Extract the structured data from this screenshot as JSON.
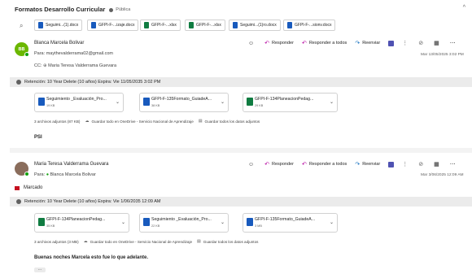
{
  "thread": {
    "title": "Formatos Desarrollo Curricular",
    "visibility": "Pública",
    "collapse_glyph": "^"
  },
  "top_attachments": [
    {
      "name": "Seguimi...(1).docx",
      "kind": "word"
    },
    {
      "name": "GFPI-F-...izaje.docx",
      "kind": "word"
    },
    {
      "name": "GFPI-F-...xlsx",
      "kind": "excel"
    },
    {
      "name": "GFPI-F-...xlsx",
      "kind": "excel"
    },
    {
      "name": "Seguimi...(1)ro.docx",
      "kind": "word"
    },
    {
      "name": "GFPI-F-...sionv.docx",
      "kind": "word"
    }
  ],
  "actions": {
    "reply": "Responder",
    "reply_all": "Responder a todos",
    "forward": "Reenviar"
  },
  "colors": {
    "avatar1": "#6bb700",
    "word": "#185abd",
    "excel": "#107c41",
    "apps": "#4f52b2",
    "reply_icon": "#b4009e",
    "forward_icon": "#0f6cbd",
    "flag": "#c50f1f"
  },
  "messages": [
    {
      "initials": "BB",
      "sender": "Blanca Marcela Bolivar",
      "to_label": "Para:",
      "to": "maythevalderrama02@gmail.com",
      "cc_label": "CC:",
      "cc": "Maria Teresa Valderrama Guevara",
      "date": "Mar 13/05/2025 3:02 PM",
      "retention": "Retención: 10 Year Delete (10 años) Expira: Vie 11/05/2035 3:02 PM",
      "attachments": [
        {
          "name": "Seguimiento _Evaluación_Pro...",
          "size": "19 KB",
          "kind": "word"
        },
        {
          "name": "GFPI-F-135Formato_GuiadeA...",
          "size": "38 KB",
          "kind": "word"
        },
        {
          "name": "GFPI-F-134PlaneacionPedag...",
          "size": "29 KB",
          "kind": "excel"
        }
      ],
      "attachments_summary": "3 archivos adjuntos (87 KB)",
      "save_onedrive": "Guardar todo en OneDrive - Servicio Nacional de Aprendizaje",
      "save_all": "Guardar todos los datos adjuntos",
      "body": "PSI"
    },
    {
      "sender": "Maria Teresa Valderrama Guevara",
      "to_label": "Para:",
      "to": "Blanca Marcela Bolivar",
      "date": "Mar 3/06/2025 12:09 AM",
      "flag": "Marcado",
      "retention": "Retención: 10 Year Delete (10 años) Expira: Vie 1/06/2035 12:09 AM",
      "attachments": [
        {
          "name": "GFPI-F-134PlaneacionPedag...",
          "size": "35 KB",
          "kind": "excel"
        },
        {
          "name": "Seguimiento _Evaluación_Pro...",
          "size": "22 KB",
          "kind": "word"
        },
        {
          "name": "GFPI-F-135Formato_GuiadeA...",
          "size": "3 MB",
          "kind": "word"
        }
      ],
      "attachments_summary": "3 archivos adjuntos (3 MB)",
      "save_onedrive": "Guardar todo en OneDrive - Servicio Nacional de Aprendizaje",
      "save_all": "Guardar todos los datos adjuntos",
      "body": "Buenas noches Marcela esto fue lo que adelante.",
      "more": "..."
    }
  ]
}
